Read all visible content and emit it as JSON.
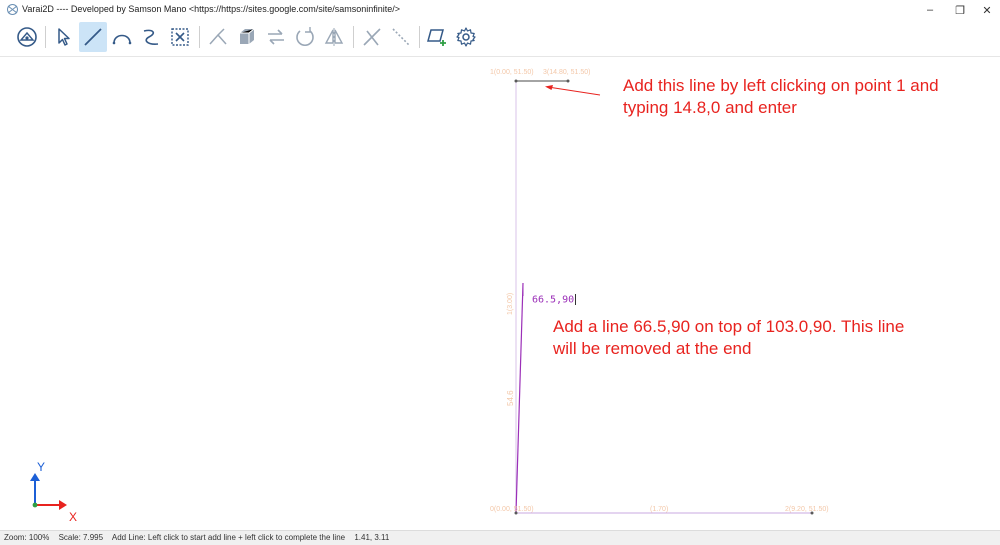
{
  "window": {
    "title": "Varai2D ---- Developed by Samson Mano <https://https://sites.google.com/site/samsoninfinite/>",
    "controls": {
      "minimize": "–",
      "restore": "❐",
      "close": "✕"
    }
  },
  "toolbar": {
    "items": [
      {
        "name": "settings-app-icon",
        "active": false
      },
      {
        "name": "select-icon",
        "active": false
      },
      {
        "name": "line-icon",
        "active": true
      },
      {
        "name": "arc-icon",
        "active": false
      },
      {
        "name": "bezier-icon",
        "active": false
      },
      {
        "name": "zoom-fit-icon",
        "active": false
      },
      {
        "name": "trim-icon",
        "active": false
      },
      {
        "name": "extrude-icon",
        "active": false
      },
      {
        "name": "move-icon",
        "active": false
      },
      {
        "name": "rotate-icon",
        "active": false
      },
      {
        "name": "mirror-icon",
        "active": false
      },
      {
        "name": "delete-icon",
        "active": false
      },
      {
        "name": "dashed-line-icon",
        "active": false
      },
      {
        "name": "add-surface-icon",
        "active": false
      },
      {
        "name": "gear-icon",
        "active": false
      }
    ]
  },
  "canvas": {
    "point_labels": {
      "top_left": "1(0.00, 51.50)",
      "top_right": "3(14.80, 51.50)",
      "bottom_left": "0(0.00, 51.50)",
      "bottom_mid": "(1.70)",
      "bottom_right": "2(9.20, 51.50)",
      "vertical_mid": "1(3.00)",
      "dim_54": "54.6"
    },
    "typed_input": "66.5,90",
    "axis": {
      "x": "X",
      "y": "Y"
    }
  },
  "annotations": {
    "top": [
      "Add this line by left clicking on point 1 and",
      "typing 14.8,0 and enter"
    ],
    "middle": [
      "Add a line 66.5,90 on top of 103.0,90. This line",
      "will be removed at the end"
    ]
  },
  "statusbar": {
    "zoom": "Zoom: 100%",
    "scale": "Scale: 7.995",
    "message": "Add Line: Left click to start add line + left click to complete the line",
    "coords": "1.41, 3.11"
  },
  "colors": {
    "active_tool": "#cce4f7",
    "annotation": "#e8231f",
    "geometry_line": "#c9a9e0",
    "active_line": "#9b2fb8",
    "point_label": "#f3c7a8",
    "axis_x": "#e8231f",
    "axis_y": "#1c5fd6"
  }
}
